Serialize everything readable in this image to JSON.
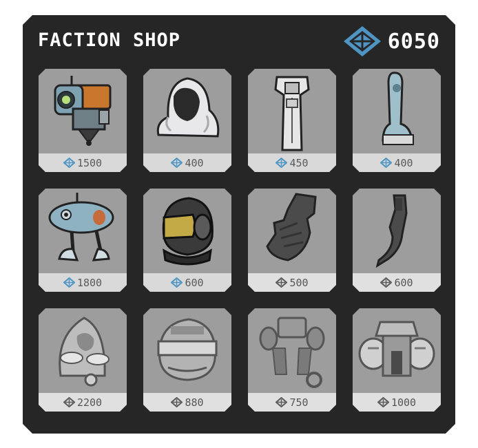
{
  "shop": {
    "title": "FACTION SHOP",
    "balance": "6050",
    "colors": {
      "gem": "#4f95c4",
      "panel": "#262626",
      "card": "#9d9d9d",
      "price_bar": "#e0e0e0"
    }
  },
  "items": [
    {
      "price": "1500",
      "icon": "robot-drone-icon",
      "unlocked": true
    },
    {
      "price": "400",
      "icon": "white-hood-icon",
      "unlocked": true
    },
    {
      "price": "450",
      "icon": "white-chestplate-icon",
      "unlocked": true
    },
    {
      "price": "400",
      "icon": "leg-armor-icon",
      "unlocked": true
    },
    {
      "price": "1800",
      "icon": "walker-robot-icon",
      "unlocked": true
    },
    {
      "price": "600",
      "icon": "black-helmet-icon",
      "unlocked": true
    },
    {
      "price": "500",
      "icon": "glove-icon",
      "unlocked": false
    },
    {
      "price": "600",
      "icon": "claw-arm-icon",
      "unlocked": false
    },
    {
      "price": "2200",
      "icon": "pod-robot-icon",
      "unlocked": false
    },
    {
      "price": "880",
      "icon": "visor-helmet-icon",
      "unlocked": false
    },
    {
      "price": "750",
      "icon": "harness-icon",
      "unlocked": false
    },
    {
      "price": "1000",
      "icon": "bulky-armor-icon",
      "unlocked": false
    }
  ]
}
